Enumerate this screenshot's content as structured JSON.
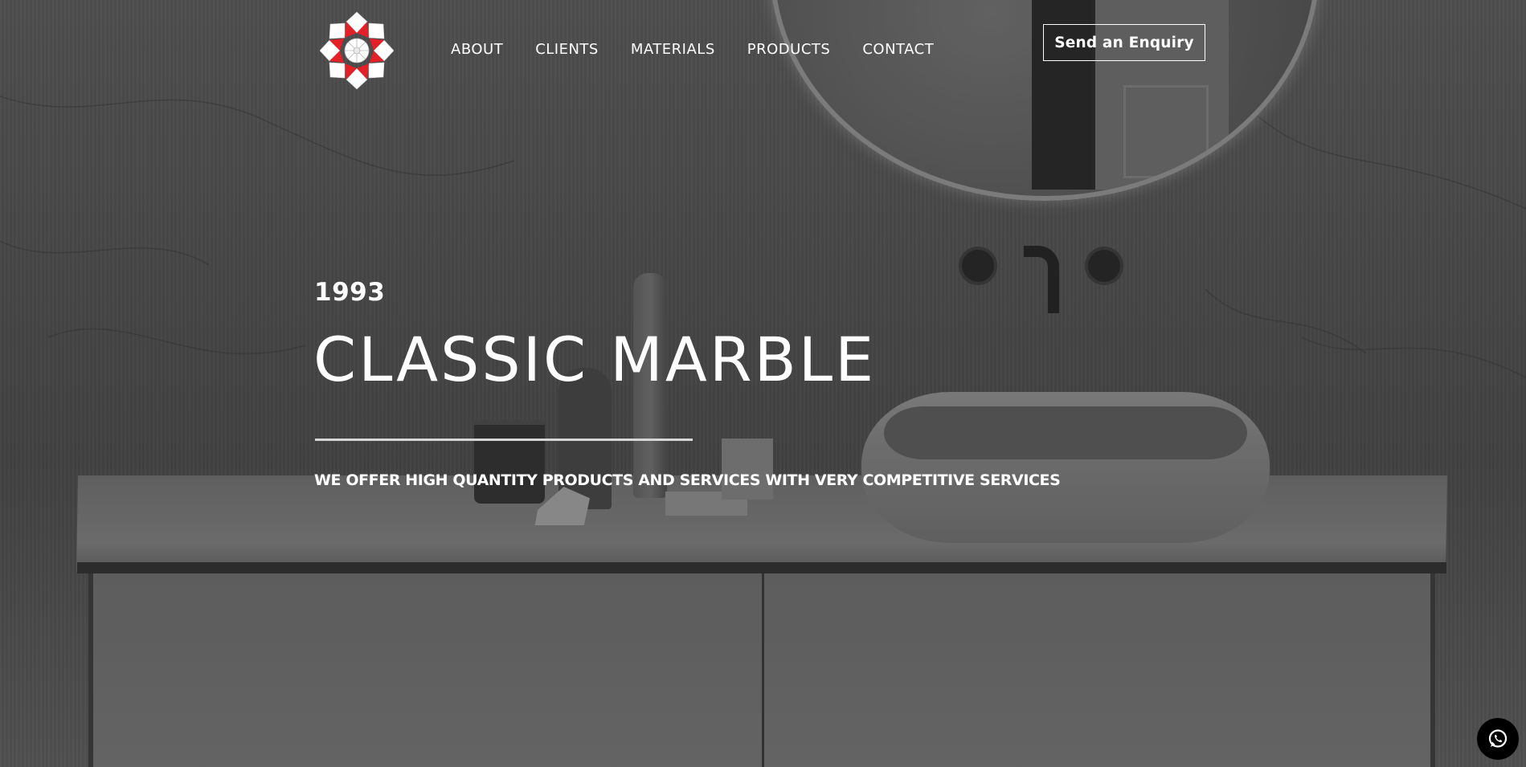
{
  "header": {
    "logo_icon": "flower-logo-icon",
    "nav": [
      "ABOUT",
      "CLIENTS",
      "MATERIALS",
      "PRODUCTS",
      "CONTACT"
    ],
    "enquiry_label": "Send an Enquiry"
  },
  "hero": {
    "year": "1993",
    "title": "CLASSIC MARBLE",
    "tagline": "WE OFFER HIGH QUANTITY PRODUCTS AND SERVICES WITH VERY COMPETITIVE SERVICES"
  },
  "floating": {
    "whatsapp_icon": "whatsapp-icon"
  },
  "colors": {
    "logo_red": "#e32028",
    "text": "#ffffff",
    "chat_bg": "#000000"
  }
}
